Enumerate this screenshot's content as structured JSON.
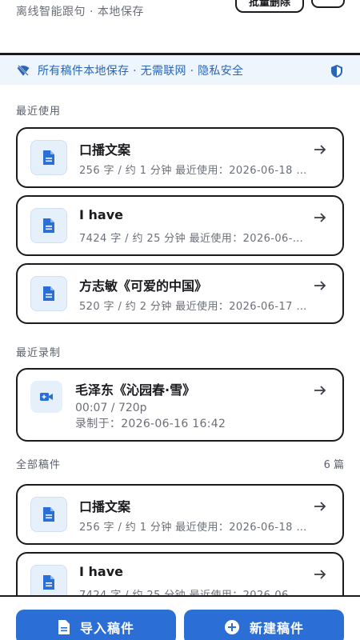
{
  "header": {
    "subtitle": "离线智能跟句 · 本地保存",
    "batch_delete_label": "批量删除"
  },
  "banner": {
    "text": "所有稿件本地保存 · 无需联网 · 隐私安全"
  },
  "recent_used": {
    "label": "最近使用",
    "items": [
      {
        "title": "口播文案",
        "meta": "256 字 / 约 1 分钟   最近使用：2026-06-18 …"
      },
      {
        "title": "I have",
        "meta": "7424 字 / 约 25 分钟   最近使用：2026-06-…"
      },
      {
        "title": "方志敏《可爱的中国》",
        "meta": "520 字 / 约 2 分钟   最近使用：2026-06-17 …"
      }
    ]
  },
  "recent_recordings": {
    "label": "最近录制",
    "items": [
      {
        "title": "毛泽东《沁园春·雪》",
        "duration": "00:07 / 720p",
        "recorded_at": "录制于：2026-06-16 16:42"
      }
    ]
  },
  "all_drafts": {
    "label": "全部稿件",
    "count": "6 篇",
    "items": [
      {
        "title": "口播文案",
        "meta": "256 字 / 约 1 分钟   最近使用：2026-06-18 …"
      },
      {
        "title": "I have",
        "meta": "7424 字 / 约 25 分钟   最近使用：2026-06-…"
      }
    ]
  },
  "actions": {
    "import_label": "导入稿件",
    "new_label": "新建稿件"
  },
  "colors": {
    "accent": "#2b6fd6",
    "banner_bg": "#eef5fd",
    "banner_text": "#2a66b5",
    "icon_bg": "#e6f0fb"
  },
  "icons": {
    "banner_left": "wifi-off-icon",
    "banner_right": "shield-icon",
    "draft": "document-icon",
    "recording": "video-icon",
    "open": "arrow-right-icon",
    "import": "document-icon",
    "new": "add-circle-icon"
  }
}
